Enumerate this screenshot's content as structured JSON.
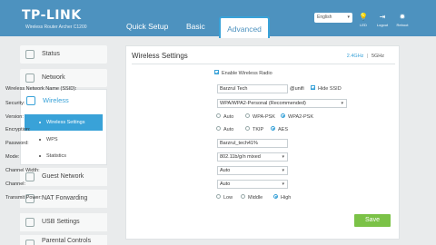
{
  "header": {
    "brand": "TP-LINK",
    "model": "Wireless Router Archer C1200",
    "tabs": [
      {
        "label": "Quick Setup"
      },
      {
        "label": "Basic"
      },
      {
        "label": "Advanced"
      }
    ],
    "language": "English",
    "icons": [
      {
        "icon": "led-icon",
        "label": "LED"
      },
      {
        "icon": "logout-icon",
        "label": "Logout"
      },
      {
        "icon": "reboot-icon",
        "label": "Reboot"
      }
    ],
    "accent": "#4d92bf"
  },
  "sidebar": {
    "items_top": [
      {
        "label": "Status"
      },
      {
        "label": "Network"
      }
    ],
    "wireless": {
      "label": "Wireless",
      "subitems": [
        {
          "label": "Wireless Settings",
          "active": true
        },
        {
          "label": "WPS"
        },
        {
          "label": "Statistics"
        }
      ]
    },
    "items_bottom": [
      {
        "label": "Guest Network"
      },
      {
        "label": "NAT Forwarding"
      },
      {
        "label": "USB Settings"
      },
      {
        "label": "Parental Controls"
      }
    ]
  },
  "panel": {
    "title": "Wireless Settings",
    "band_active": "2.4GHz",
    "band_sep": "|",
    "band_other": "5GHz",
    "enable_radio": "Enable Wireless Radio",
    "ssid_label": "Wireless Network Name (SSID):",
    "ssid_value": "Barzrul Tech",
    "ssid_suffix": "@unifi",
    "hide_ssid": "Hide SSID",
    "security_label": "Security:",
    "security_value": "WPA/WPA2-Personal (Recommended)",
    "version_label": "Version:",
    "version_options": [
      "Auto",
      "WPA-PSK",
      "WPA2-PSK"
    ],
    "version_selected": "WPA2-PSK",
    "encryption_label": "Encryption:",
    "encryption_options": [
      "Auto",
      "TKIP",
      "AES"
    ],
    "encryption_selected": "AES",
    "password_label": "Password:",
    "password_value": "Barzrul_tech41%",
    "mode_label": "Mode:",
    "mode_value": "802.11b/g/n mixed",
    "width_label": "Channel Width:",
    "width_value": "Auto",
    "channel_label": "Channel:",
    "channel_value": "Auto",
    "power_label": "Transmit Power:",
    "power_options": [
      "Low",
      "Middle",
      "High"
    ],
    "power_selected": "High",
    "save_label": "Save",
    "save_color": "#7bc247"
  }
}
